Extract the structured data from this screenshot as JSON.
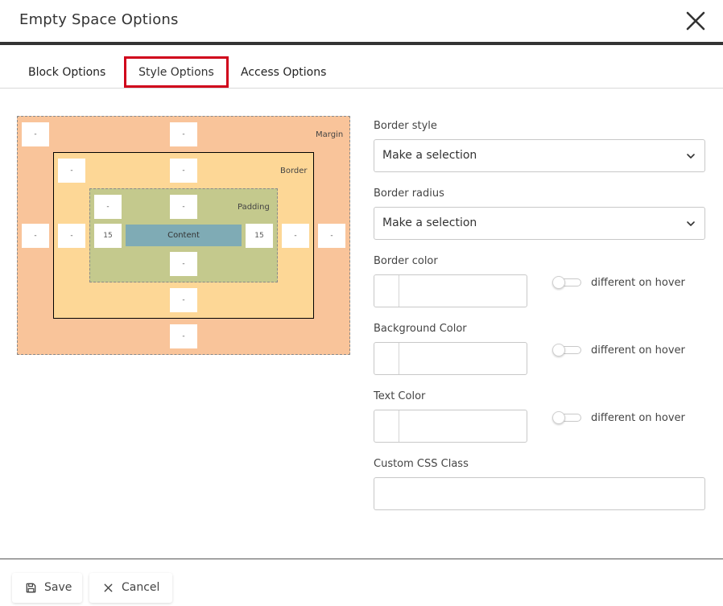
{
  "dialog": {
    "title": "Empty Space Options"
  },
  "tabs": [
    {
      "label": "Block Options"
    },
    {
      "label": "Style Options",
      "active": true
    },
    {
      "label": "Access Options"
    }
  ],
  "box_model": {
    "margin_label": "Margin",
    "border_label": "Border",
    "padding_label": "Padding",
    "content_label": "Content",
    "margin": {
      "top": "-",
      "right": "-",
      "bottom": "-",
      "left": "-"
    },
    "border": {
      "top": "-",
      "right": "-",
      "bottom": "-",
      "left": "-"
    },
    "padding": {
      "top": "-",
      "right": "15",
      "bottom": "-",
      "left": "15"
    },
    "colors": {
      "margin": "#f9c49a",
      "border": "#fdd796",
      "padding": "#c4c98d",
      "content": "#7fabb5"
    }
  },
  "form": {
    "border_style": {
      "label": "Border style",
      "value": "Make a selection"
    },
    "border_radius": {
      "label": "Border radius",
      "value": "Make a selection"
    },
    "border_color": {
      "label": "Border color",
      "value": "",
      "hover_label": "different on hover",
      "hover_enabled": false
    },
    "background_color": {
      "label": "Background Color",
      "value": "",
      "hover_label": "different on hover",
      "hover_enabled": false
    },
    "text_color": {
      "label": "Text Color",
      "value": "",
      "hover_label": "different on hover",
      "hover_enabled": false
    },
    "custom_css": {
      "label": "Custom CSS Class",
      "value": ""
    }
  },
  "footer": {
    "save_label": "Save",
    "cancel_label": "Cancel"
  },
  "icons": {
    "close": "close-icon",
    "save": "floppy-disk-icon",
    "cancel": "x-icon",
    "dropdown": "chevron-down-icon"
  },
  "accent": {
    "active_tab_border": "#d0021b"
  }
}
